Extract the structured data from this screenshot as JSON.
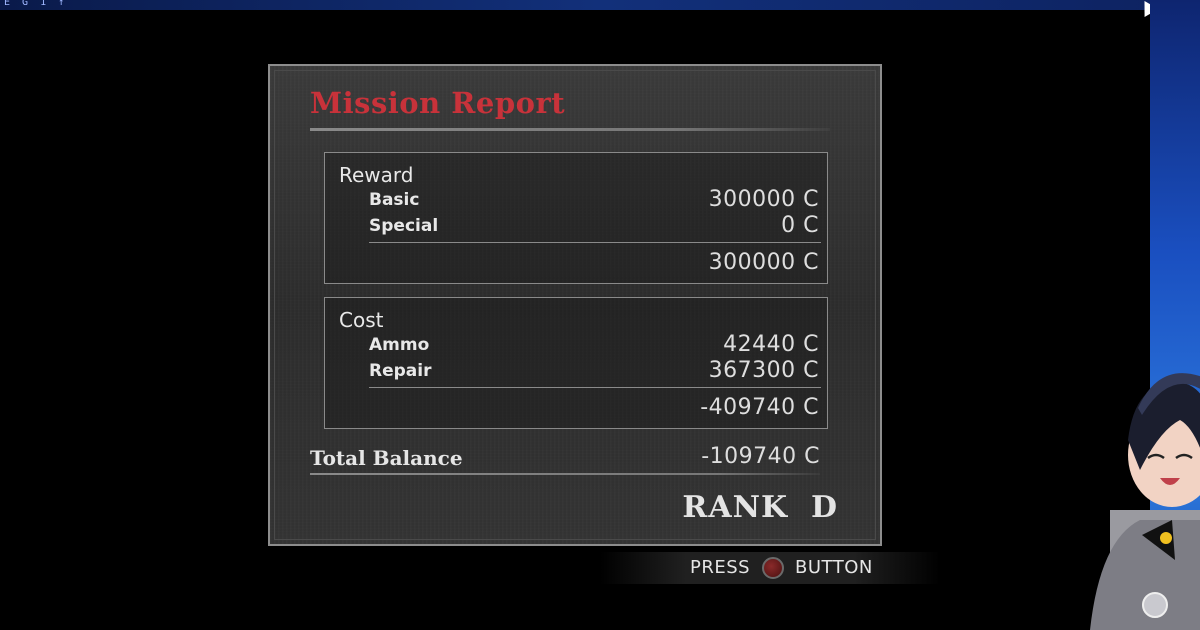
{
  "top_bar": {
    "glyphs": "E G 1 ↑"
  },
  "report": {
    "title": "Mission Report",
    "reward": {
      "label": "Reward",
      "basic_label": "Basic",
      "basic_value": "300000 C",
      "special_label": "Special",
      "special_value": "0 C",
      "subtotal": "300000 C"
    },
    "cost": {
      "label": "Cost",
      "ammo_label": "Ammo",
      "ammo_value": "42440 C",
      "repair_label": "Repair",
      "repair_value": "367300 C",
      "subtotal": "-409740 C"
    },
    "total_label": "Total Balance",
    "total_value": "-109740 C",
    "rank": "RANK  D"
  },
  "prompt": {
    "press": "PRESS",
    "button": "BUTTON",
    "button_icon": "circle-button-icon"
  },
  "colors": {
    "title": "#c8323a",
    "text": "#e6e6e6",
    "panel": "#333333",
    "border": "#8d8d8d"
  }
}
